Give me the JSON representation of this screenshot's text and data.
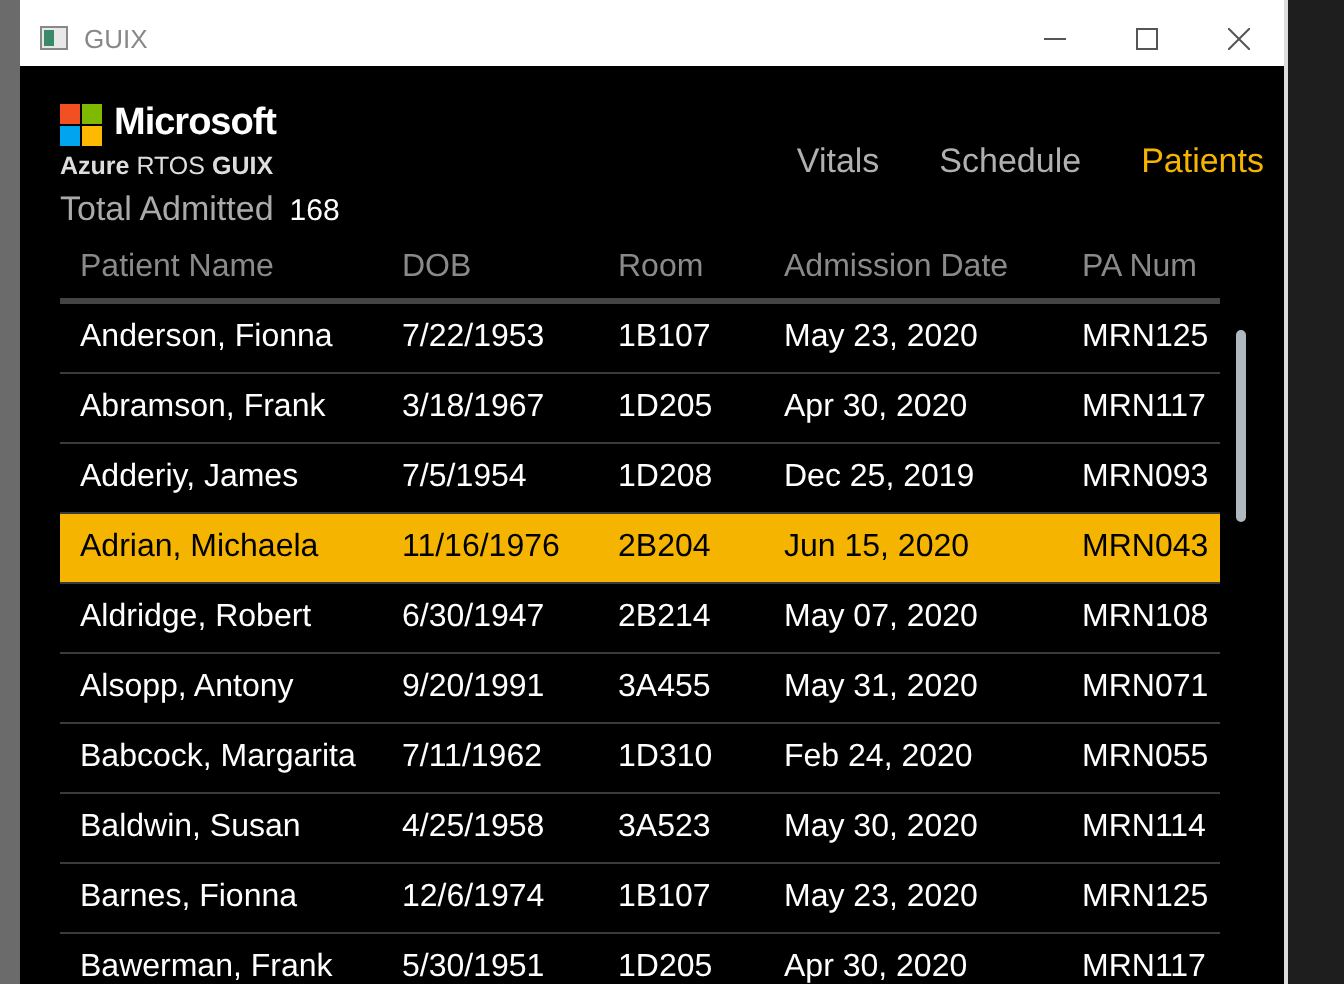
{
  "window": {
    "title": "GUIX"
  },
  "brand": {
    "company": "Microsoft",
    "product_parts": [
      "Azure",
      "RTOS",
      "GUIX"
    ]
  },
  "tabs": [
    {
      "label": "Vitals",
      "selected": false
    },
    {
      "label": "Schedule",
      "selected": false
    },
    {
      "label": "Patients",
      "selected": true
    }
  ],
  "summary": {
    "label": "Total Admitted",
    "value": "168"
  },
  "table": {
    "columns": [
      "Patient Name",
      "DOB",
      "Room",
      "Admission Date",
      "PA Num"
    ],
    "rows": [
      {
        "cells": [
          "Anderson, Fionna",
          "7/22/1953",
          "1B107",
          "May 23, 2020",
          "MRN125"
        ],
        "selected": false
      },
      {
        "cells": [
          "Abramson, Frank",
          "3/18/1967",
          "1D205",
          "Apr 30, 2020",
          "MRN117"
        ],
        "selected": false
      },
      {
        "cells": [
          "Adderiy, James",
          "7/5/1954",
          "1D208",
          "Dec 25, 2019",
          "MRN093"
        ],
        "selected": false
      },
      {
        "cells": [
          "Adrian, Michaela",
          "11/16/1976",
          "2B204",
          "Jun 15, 2020",
          "MRN043"
        ],
        "selected": true
      },
      {
        "cells": [
          "Aldridge, Robert",
          "6/30/1947",
          "2B214",
          "May 07, 2020",
          "MRN108"
        ],
        "selected": false
      },
      {
        "cells": [
          "Alsopp, Antony",
          "9/20/1991",
          "3A455",
          "May 31, 2020",
          "MRN071"
        ],
        "selected": false
      },
      {
        "cells": [
          "Babcock, Margarita",
          "7/11/1962",
          "1D310",
          "Feb 24, 2020",
          "MRN055"
        ],
        "selected": false
      },
      {
        "cells": [
          "Baldwin, Susan",
          "4/25/1958",
          "3A523",
          "May 30, 2020",
          "MRN114"
        ],
        "selected": false
      },
      {
        "cells": [
          "Barnes, Fionna",
          "12/6/1974",
          "1B107",
          "May 23, 2020",
          "MRN125"
        ],
        "selected": false
      },
      {
        "cells": [
          "Bawerman, Frank",
          "5/30/1951",
          "1D205",
          "Apr 30, 2020",
          "MRN117"
        ],
        "selected": false
      }
    ]
  }
}
